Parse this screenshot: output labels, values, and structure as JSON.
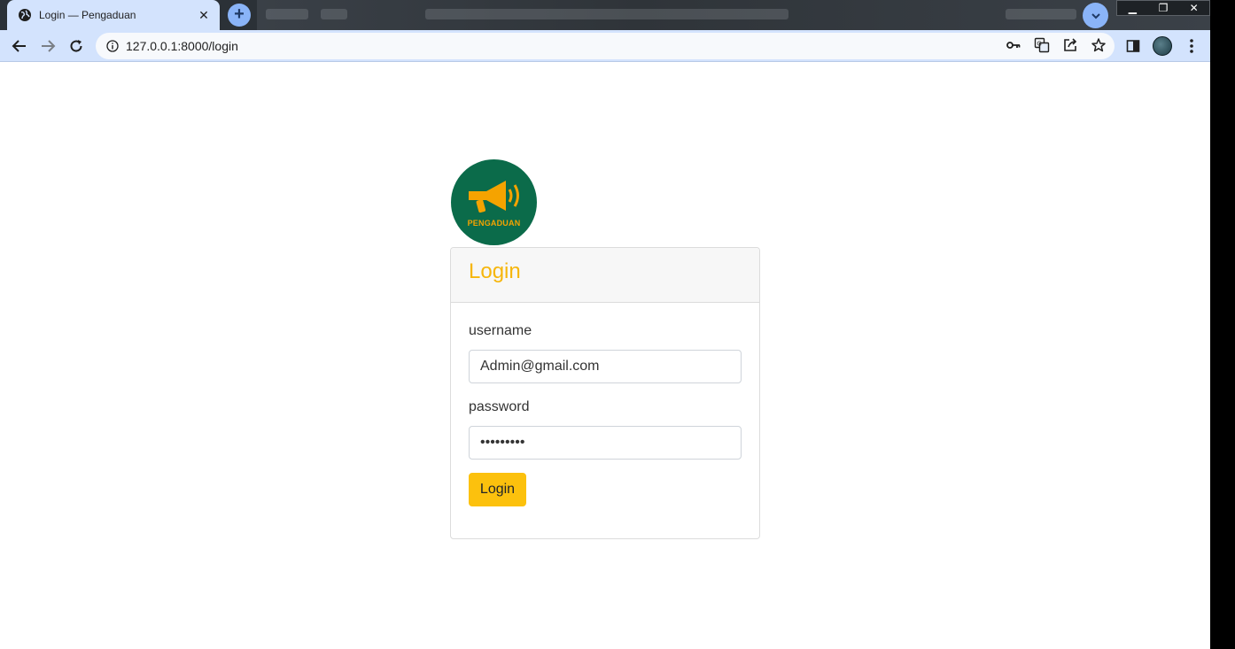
{
  "browser": {
    "tab_title": "Login — Pengaduan",
    "url": "127.0.0.1:8000/login",
    "colors": {
      "tab_active": "#d3e3fd",
      "tabstrip": "#2b3137",
      "accent": "#8ab4f8"
    }
  },
  "logo": {
    "text": "PENGADUAN",
    "colors": {
      "background": "#0b6b4a",
      "foreground": "#f5a300"
    }
  },
  "login_card": {
    "title": "Login",
    "username_label": "username",
    "username_value": "Admin@gmail.com",
    "password_label": "password",
    "password_mask": "•••••••••",
    "submit_label": "Login",
    "colors": {
      "title": "#f6b60c",
      "button": "#fcc10d"
    }
  }
}
